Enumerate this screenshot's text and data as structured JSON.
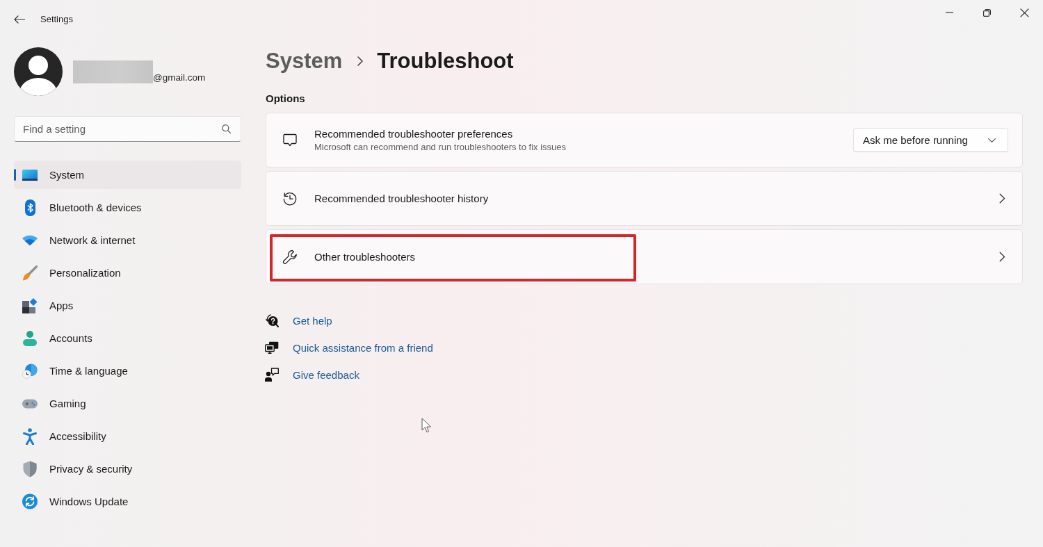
{
  "window": {
    "title": "Settings"
  },
  "account": {
    "name_redacted": true,
    "email": "@gmail.com"
  },
  "search": {
    "placeholder": "Find a setting"
  },
  "sidebar": {
    "items": [
      {
        "label": "System",
        "selected": true
      },
      {
        "label": "Bluetooth & devices",
        "selected": false
      },
      {
        "label": "Network & internet",
        "selected": false
      },
      {
        "label": "Personalization",
        "selected": false
      },
      {
        "label": "Apps",
        "selected": false
      },
      {
        "label": "Accounts",
        "selected": false
      },
      {
        "label": "Time & language",
        "selected": false
      },
      {
        "label": "Gaming",
        "selected": false
      },
      {
        "label": "Accessibility",
        "selected": false
      },
      {
        "label": "Privacy & security",
        "selected": false
      },
      {
        "label": "Windows Update",
        "selected": false
      }
    ]
  },
  "breadcrumb": {
    "parent": "System",
    "current": "Troubleshoot"
  },
  "options": {
    "heading": "Options",
    "items": [
      {
        "kind": "dropdown",
        "title": "Recommended troubleshooter preferences",
        "description": "Microsoft can recommend and run troubleshooters to fix issues",
        "value": "Ask me before running",
        "highlighted": false
      },
      {
        "kind": "link",
        "title": "Recommended troubleshooter history",
        "highlighted": false
      },
      {
        "kind": "link",
        "title": "Other troubleshooters",
        "highlighted": true
      }
    ]
  },
  "help_links": [
    {
      "label": "Get help"
    },
    {
      "label": "Quick assistance from a friend"
    },
    {
      "label": "Give feedback"
    }
  ]
}
